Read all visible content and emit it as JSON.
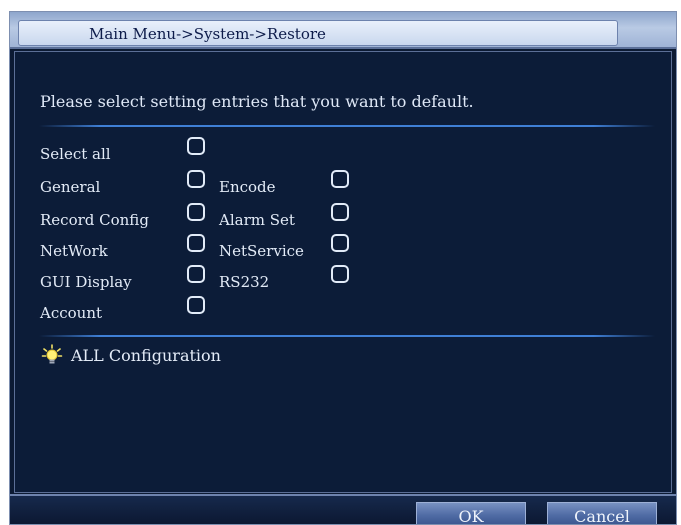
{
  "window": {
    "title": "Main Menu->System->Restore"
  },
  "main": {
    "instruction": "Please select setting entries that you want to default.",
    "options": [
      {
        "label": "Select all",
        "checked": false
      },
      {
        "label": "General",
        "checked": false
      },
      {
        "label": "Encode",
        "checked": false
      },
      {
        "label": "Record Config",
        "checked": false
      },
      {
        "label": "Alarm Set",
        "checked": false
      },
      {
        "label": "NetWork",
        "checked": false
      },
      {
        "label": "NetService",
        "checked": false
      },
      {
        "label": "GUI Display",
        "checked": false
      },
      {
        "label": "RS232",
        "checked": false
      },
      {
        "label": "Account",
        "checked": false
      }
    ],
    "tip": {
      "icon": "lightbulb-icon",
      "text": "ALL Configuration"
    }
  },
  "footer": {
    "ok_label": "OK",
    "cancel_label": "Cancel"
  },
  "colors": {
    "background": "#0c1c38",
    "divider": "#3f7fd6",
    "titlebar": "#b9cae4",
    "button": "#4f6ba4",
    "text": "#e3ebf7"
  }
}
